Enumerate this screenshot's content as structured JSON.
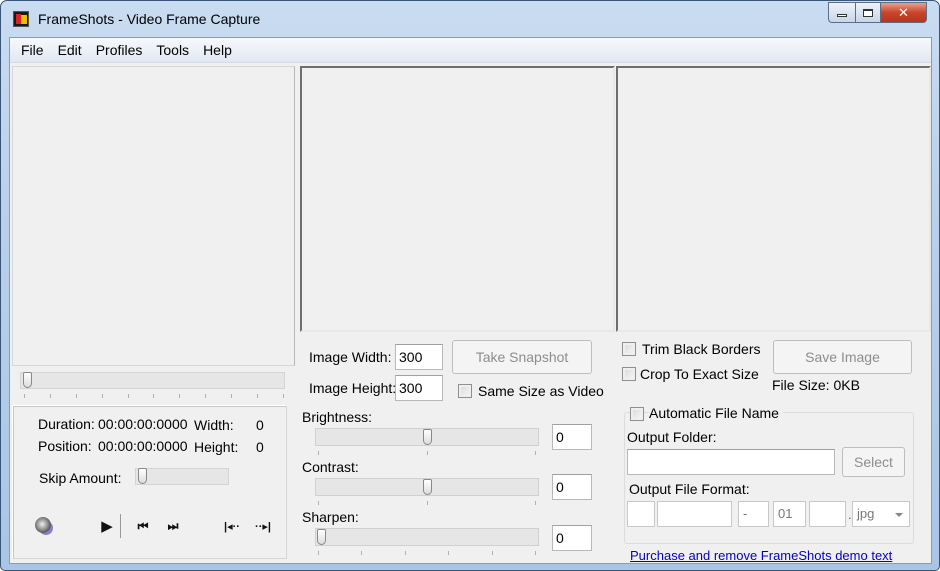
{
  "window": {
    "title": "FrameShots - Video Frame Capture",
    "controls": {
      "minimize": "minimize",
      "maximize": "maximize",
      "close": "✕"
    }
  },
  "menu": [
    {
      "label": "File"
    },
    {
      "label": "Edit"
    },
    {
      "label": "Profiles"
    },
    {
      "label": "Tools"
    },
    {
      "label": "Help"
    }
  ],
  "player": {
    "seek_position": 0,
    "duration_label": "Duration:",
    "duration_value": "00:00:00:0000",
    "position_label": "Position:",
    "position_value": "00:00:00:0000",
    "width_label": "Width:",
    "width_value": "0",
    "height_label": "Height:",
    "height_value": "0",
    "skip_label": "Skip Amount:",
    "skip_value": 0,
    "transport": {
      "volume": "speaker-icon",
      "play": "▶",
      "prev": "⏮",
      "next": "⏭",
      "step_back": "|◂··",
      "step_forward": "··▸|"
    }
  },
  "snapshot": {
    "image_width_label": "Image Width:",
    "image_width_value": "300",
    "image_height_label": "Image Height:",
    "image_height_value": "300",
    "take_snapshot_label": "Take Snapshot",
    "same_size_label": "Same Size as Video",
    "same_size_checked": false,
    "brightness_label": "Brightness:",
    "brightness_value": "0",
    "brightness_slider": 0.5,
    "contrast_label": "Contrast:",
    "contrast_value": "0",
    "contrast_slider": 0.5,
    "sharpen_label": "Sharpen:",
    "sharpen_value": "0",
    "sharpen_slider": 0
  },
  "save": {
    "trim_label": "Trim Black Borders",
    "trim_checked": false,
    "crop_label": "Crop To Exact Size",
    "crop_checked": false,
    "save_image_label": "Save Image",
    "file_size": "File Size: 0KB",
    "auto_name_label": "Automatic File Name",
    "auto_name_checked": false,
    "output_folder_label": "Output Folder:",
    "output_folder_value": "",
    "select_label": "Select",
    "output_format_label": "Output File Format:",
    "format_fields": [
      "",
      "",
      "-",
      "01",
      ""
    ],
    "format_dot": ".",
    "format_ext": "jpg",
    "purchase_link": "Purchase and remove FrameShots demo text"
  },
  "colors": {
    "link": "#0000cc",
    "close_button": "#c9452c",
    "disabled_text": "#8d8d8d"
  }
}
